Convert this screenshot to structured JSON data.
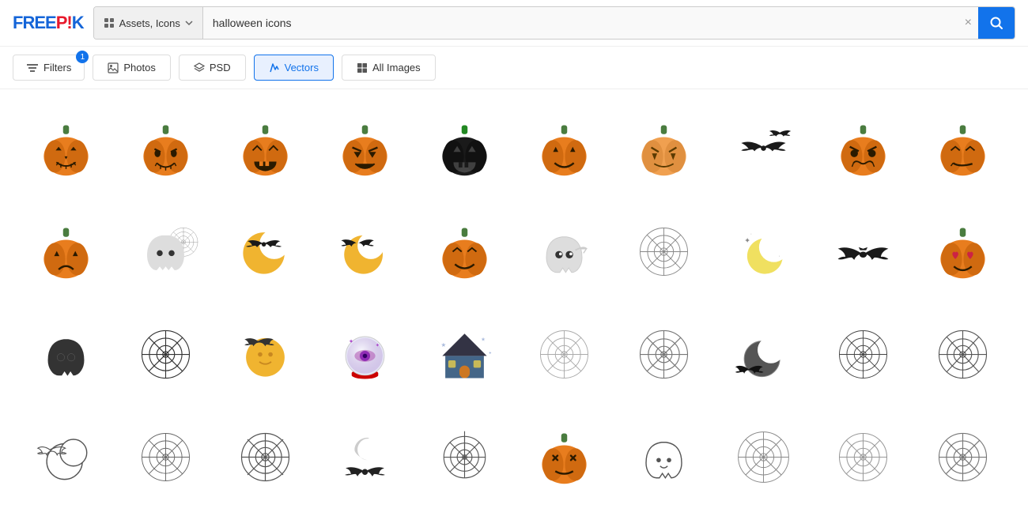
{
  "header": {
    "logo": "FREEPIK",
    "search_category": "Assets, Icons",
    "search_value": "halloween icons",
    "search_placeholder": "halloween icons",
    "clear_label": "×",
    "search_icon": "🔍"
  },
  "filter_bar": {
    "filter_label": "Filters",
    "filter_badge": "1",
    "tabs": [
      {
        "id": "photos",
        "label": "Photos",
        "icon": "photo"
      },
      {
        "id": "psd",
        "label": "PSD",
        "icon": "layers"
      },
      {
        "id": "vectors",
        "label": "Vectors",
        "icon": "vector",
        "active": true
      },
      {
        "id": "all-images",
        "label": "All Images",
        "icon": "grid"
      }
    ]
  },
  "grid": {
    "rows": 4,
    "cols": 10
  }
}
